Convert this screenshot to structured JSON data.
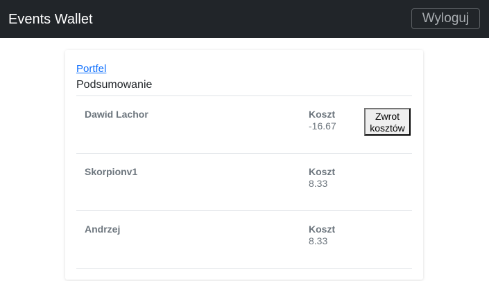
{
  "navbar": {
    "brand": "Events Wallet",
    "logout_label": "Wyloguj"
  },
  "card": {
    "back_link": "Portfel",
    "title": "Podsumowanie",
    "rows": [
      {
        "name": "Dawid Lachor",
        "cost_label": "Koszt",
        "cost_value": "-16.67",
        "action_label": "Zwrot kosztów"
      },
      {
        "name": "Skorpionv1",
        "cost_label": "Koszt",
        "cost_value": "8.33"
      },
      {
        "name": "Andrzej",
        "cost_label": "Koszt",
        "cost_value": "8.33"
      }
    ]
  }
}
